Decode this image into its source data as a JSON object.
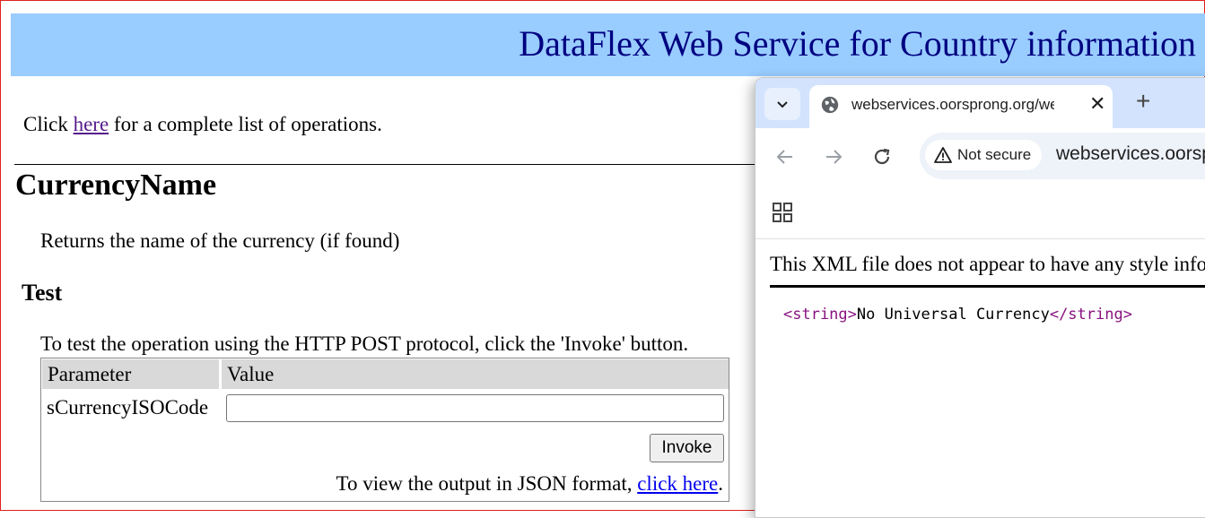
{
  "page": {
    "banner_title": "DataFlex Web Service for Country information",
    "intro_before": "Click ",
    "intro_link": "here",
    "intro_after": " for a complete list of operations.",
    "operation_name": "CurrencyName",
    "operation_description": "Returns the name of the currency (if found)",
    "test_heading": "Test",
    "test_description": "To test the operation using the HTTP POST protocol, click the 'Invoke' button.",
    "table": {
      "header_parameter": "Parameter",
      "header_value": "Value",
      "param_name": "sCurrencyISOCode",
      "param_value": "",
      "invoke_label": "Invoke",
      "json_note_before": "To view the output in JSON format, ",
      "json_link": "click here",
      "json_note_after": "."
    }
  },
  "browser": {
    "tab_title": "webservices.oorsprong.org/websamples.countryinfo",
    "new_tab_symbol": "+",
    "close_symbol": "✕",
    "not_secure_label": "Not secure",
    "url": "webservices.oorsprong.org",
    "xml_message": "This XML file does not appear to have any style information associated with it.",
    "xml": {
      "open_tag": "<string>",
      "text": "No Universal Currency",
      "close_tag": "</string>"
    }
  },
  "icons": {
    "tab_menu": "chevron-down-icon",
    "tab_site": "globe-icon",
    "back": "arrow-left-icon",
    "forward": "arrow-right-icon",
    "reload": "reload-icon",
    "warning": "warning-icon",
    "apps": "apps-grid-icon"
  },
  "colors": {
    "banner_bg": "#99ccff",
    "banner_text": "#000080",
    "visited_link": "#551a8b",
    "link": "#0000ee",
    "tabstrip": "#d3e3fd",
    "xml_tag": "#881280"
  }
}
